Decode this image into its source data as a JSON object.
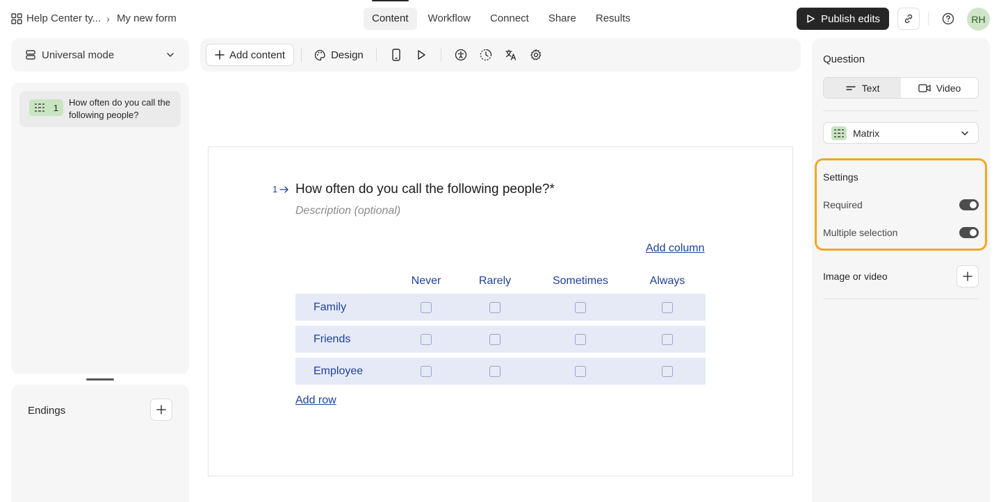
{
  "breadcrumb": {
    "workspace": "Help Center ty...",
    "form": "My new form"
  },
  "tabs": [
    {
      "label": "Content"
    },
    {
      "label": "Workflow"
    },
    {
      "label": "Connect"
    },
    {
      "label": "Share"
    },
    {
      "label": "Results"
    }
  ],
  "header": {
    "publish_label": "Publish edits",
    "avatar_initials": "RH"
  },
  "left": {
    "mode_label": "Universal mode",
    "questions": [
      {
        "number": "1",
        "title": "How often do you call the following people?"
      }
    ],
    "endings_label": "Endings"
  },
  "toolbar": {
    "add_content_label": "Add content",
    "design_label": "Design"
  },
  "question": {
    "number": "1",
    "title": "How often do you call the following people?*",
    "description_placeholder": "Description (optional)",
    "add_column_label": "Add column",
    "add_row_label": "Add row",
    "columns": [
      "Never",
      "Rarely",
      "Sometimes",
      "Always"
    ],
    "rows": [
      "Family",
      "Friends",
      "Employee"
    ]
  },
  "right": {
    "title": "Question",
    "text_label": "Text",
    "video_label": "Video",
    "type_label": "Matrix",
    "settings_title": "Settings",
    "required_label": "Required",
    "required_on": true,
    "multiple_label": "Multiple selection",
    "multiple_on": true,
    "image_video_label": "Image or video"
  },
  "colors": {
    "accent_blue": "#1f3f9a",
    "row_bg": "#e5eaf6",
    "badge_green": "#c9e4c1",
    "highlight": "#f5a623"
  }
}
